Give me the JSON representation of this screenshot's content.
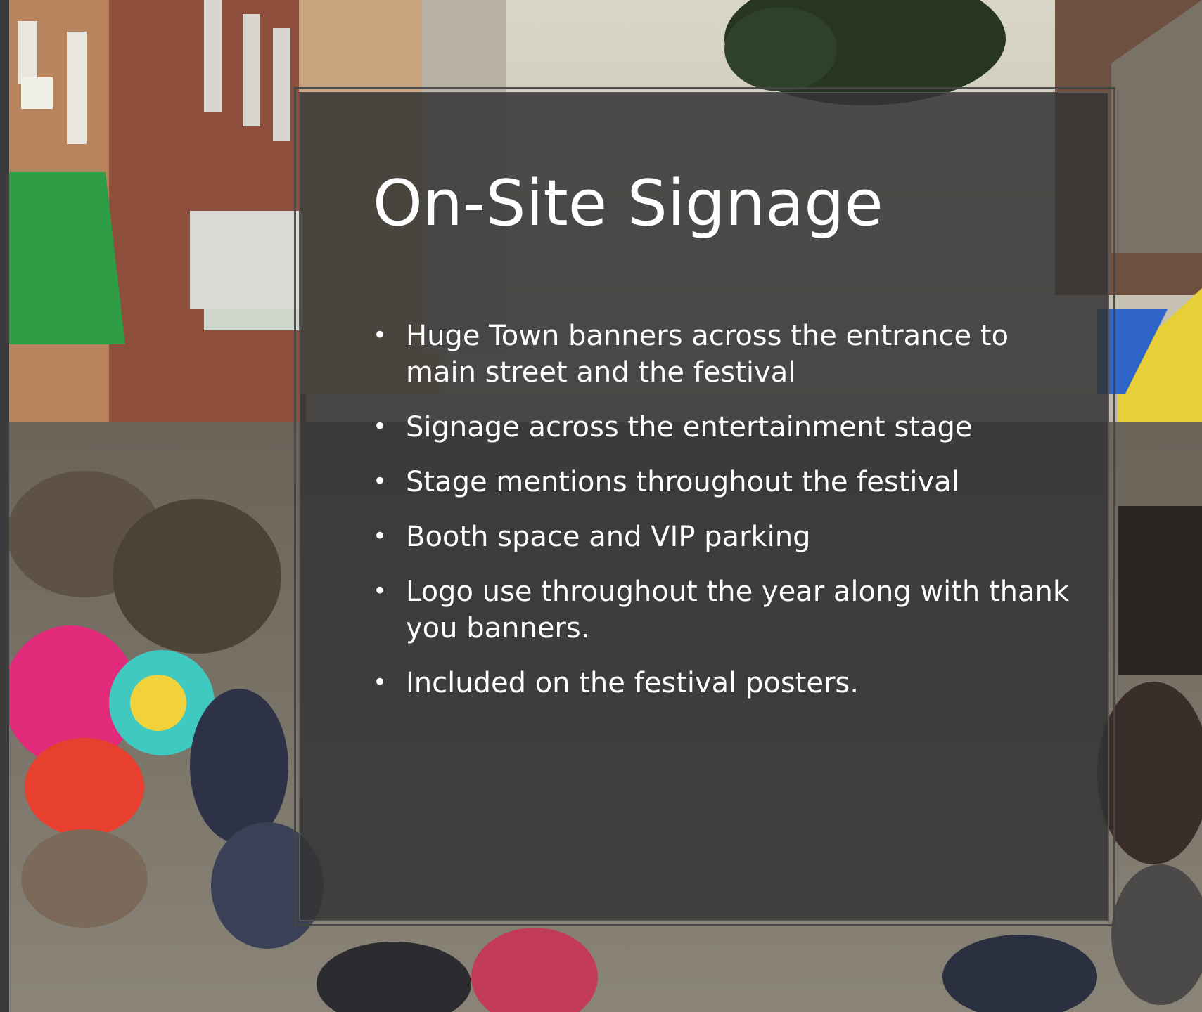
{
  "slide": {
    "title": "On-Site Signage",
    "bullets": [
      "Huge Town banners across the entrance to main street and the festival",
      "Signage across the entertainment stage",
      "Stage mentions throughout the festival",
      "Booth space and VIP parking",
      "Logo use throughout the year along with thank you banners.",
      "Included on the festival posters."
    ],
    "bullet_glyph": "•"
  },
  "colors": {
    "panel": "#343434",
    "text": "#ffffff"
  }
}
